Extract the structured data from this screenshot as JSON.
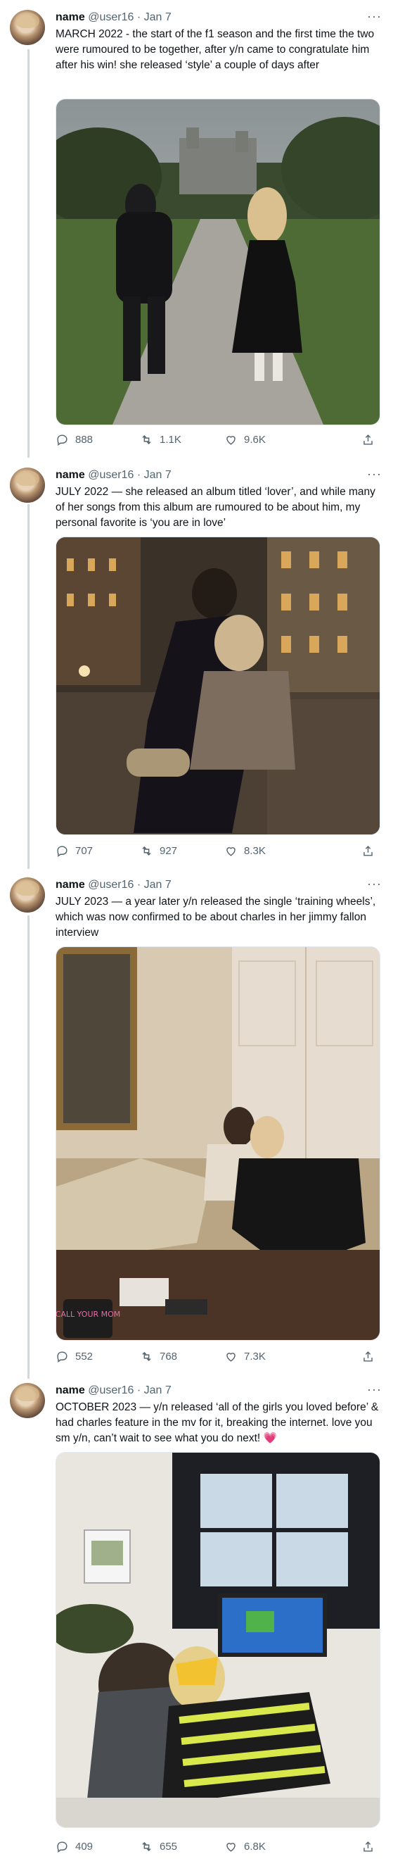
{
  "colors": {
    "line": "#cfd9de",
    "secondary": "#536471",
    "text": "#0f1419"
  },
  "tweets": [
    {
      "name": "name",
      "handle": "@user16",
      "date": "Jan 7",
      "text": "MARCH 2022 - the start of the f1 season and the first time the two were rumoured to be together, after y/n came to congratulate him after his win! she released ‘style’ a couple of days after",
      "stats": {
        "replies": "888",
        "retweets": "1.1K",
        "likes": "9.6K"
      }
    },
    {
      "name": "name",
      "handle": "@user16",
      "date": "Jan 7",
      "text": "JULY 2022 — she released an album titled ‘lover’, and while many of her songs from this album are rumoured to be about him, my personal favorite is ‘you are in love’",
      "stats": {
        "replies": "707",
        "retweets": "927",
        "likes": "8.3K"
      }
    },
    {
      "name": "name",
      "handle": "@user16",
      "date": "Jan 7",
      "text": "JULY 2023 — a year later y/n released the single ‘training wheels’, which was now confirmed to be about charles in her jimmy fallon interview",
      "stats": {
        "replies": "552",
        "retweets": "768",
        "likes": "7.3K"
      },
      "mug_text": "CALL YOUR MOM"
    },
    {
      "name": "name",
      "handle": "@user16",
      "date": "Jan 7",
      "text": "OCTOBER 2023 — y/n released ‘all of the girls you loved before’ & had charles feature in the mv for it, breaking the internet. love you sm y/n, can’t wait to see what you do next! 💗",
      "stats": {
        "replies": "409",
        "retweets": "655",
        "likes": "6.8K"
      }
    }
  ]
}
